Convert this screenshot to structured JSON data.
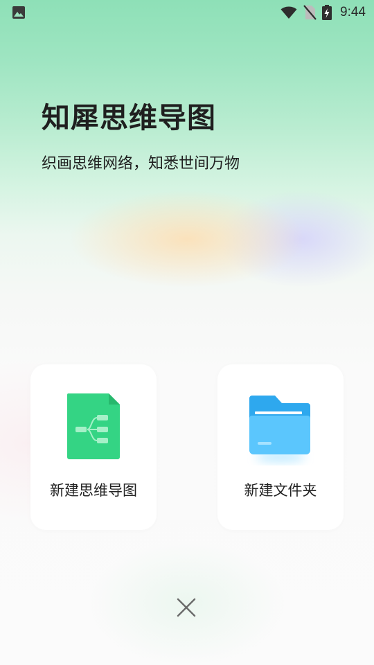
{
  "status_bar": {
    "time": "9:44",
    "left_icon": "image-notification-icon",
    "icons": [
      "wifi-icon",
      "no-sim-icon",
      "battery-charging-icon"
    ]
  },
  "header": {
    "title": "知犀思维导图",
    "subtitle": "织画思维网络，知悉世间万物"
  },
  "actions": [
    {
      "label": "新建思维导图",
      "icon": "mindmap-file-icon",
      "color": "#34d484"
    },
    {
      "label": "新建文件夹",
      "icon": "folder-icon",
      "color": "#42b4f2"
    }
  ],
  "close": {
    "icon": "close-icon"
  },
  "colors": {
    "accent_green": "#34d484",
    "folder_blue": "#42b4f2",
    "text": "#1f1f1f"
  }
}
